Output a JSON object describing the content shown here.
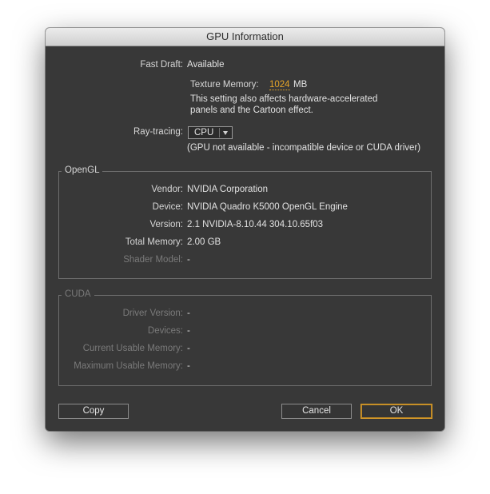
{
  "window": {
    "title": "GPU Information"
  },
  "fast_draft": {
    "label": "Fast Draft:",
    "value": "Available"
  },
  "texture_memory": {
    "label": "Texture Memory:",
    "value": "1024",
    "unit": "MB",
    "note_line1": "This setting also affects hardware-accelerated",
    "note_line2": "panels and the Cartoon effect."
  },
  "ray_tracing": {
    "label": "Ray-tracing:",
    "selected": "CPU",
    "note": "(GPU not available - incompatible device or CUDA driver)"
  },
  "opengl": {
    "title": "OpenGL",
    "rows": [
      {
        "label": "Vendor:",
        "value": "NVIDIA Corporation"
      },
      {
        "label": "Device:",
        "value": "NVIDIA Quadro K5000 OpenGL Engine"
      },
      {
        "label": "Version:",
        "value": "2.1 NVIDIA-8.10.44 304.10.65f03"
      },
      {
        "label": "Total Memory:",
        "value": "2.00 GB"
      },
      {
        "label": "Shader Model:",
        "value": "-"
      }
    ]
  },
  "cuda": {
    "title": "CUDA",
    "rows": [
      {
        "label": "Driver Version:",
        "value": "-"
      },
      {
        "label": "Devices:",
        "value": "-"
      },
      {
        "label": "Current Usable Memory:",
        "value": "-"
      },
      {
        "label": "Maximum Usable Memory:",
        "value": "-"
      }
    ]
  },
  "buttons": {
    "copy": "Copy",
    "cancel": "Cancel",
    "ok": "OK"
  },
  "colors": {
    "background": "#383838",
    "accent": "#e6a528",
    "text": "#e2e2e2",
    "disabled_text": "#7a7a7a"
  }
}
